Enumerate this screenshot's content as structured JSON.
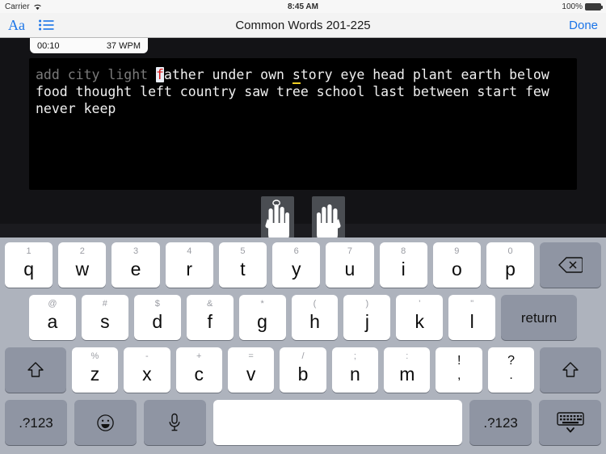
{
  "status_bar": {
    "carrier": "Carrier",
    "wifi_icon": "wifi-icon",
    "time": "8:45 AM",
    "battery_percent": "100%",
    "battery_icon": "battery-icon"
  },
  "nav_bar": {
    "font_button_label": "Aa",
    "font_button_icon": "font-size-icon",
    "list_button_icon": "list-icon",
    "title": "Common Words 201-225",
    "done_label": "Done",
    "accent_color": "#1a74e8"
  },
  "practice": {
    "timer": "00:10",
    "speed": "37 WPM",
    "lines": [
      {
        "segments": [
          {
            "text": "add city light ",
            "state": "done"
          },
          {
            "text": "f",
            "state": "cursor"
          },
          {
            "text": "ather under own ",
            "state": "pending"
          },
          {
            "text": "s",
            "state": "hint"
          },
          {
            "text": "tory eye head plant earth below",
            "state": "pending"
          }
        ]
      },
      {
        "segments": [
          {
            "text": "food thought left country saw tree school last between start few",
            "state": "pending"
          }
        ]
      },
      {
        "segments": [
          {
            "text": "never keep",
            "state": "pending"
          }
        ]
      }
    ],
    "hands": [
      {
        "name": "left-hand-diagram",
        "highlight_finger": "index"
      },
      {
        "name": "right-hand-diagram",
        "highlight_finger": "none"
      }
    ],
    "colors": {
      "background": "#131316",
      "panel": "#000000",
      "typed_text": "#7b7b7b",
      "pending_text": "#f0f0f0",
      "cursor_text": "#d81414",
      "cursor_background": "#e9eef6",
      "hint_underline": "#f2d024"
    }
  },
  "keyboard": {
    "rows": [
      {
        "name": "keyboard-row-1",
        "keys": [
          {
            "main": "q",
            "alt": "1"
          },
          {
            "main": "w",
            "alt": "2"
          },
          {
            "main": "e",
            "alt": "3"
          },
          {
            "main": "r",
            "alt": "4"
          },
          {
            "main": "t",
            "alt": "5"
          },
          {
            "main": "y",
            "alt": "6"
          },
          {
            "main": "u",
            "alt": "7"
          },
          {
            "main": "i",
            "alt": "8"
          },
          {
            "main": "o",
            "alt": "9"
          },
          {
            "main": "p",
            "alt": "0"
          },
          {
            "main": "",
            "alt": "",
            "icon": "backspace-icon",
            "name": "backspace-key"
          }
        ]
      },
      {
        "name": "keyboard-row-2",
        "keys": [
          {
            "main": "a",
            "alt": "@"
          },
          {
            "main": "s",
            "alt": "#"
          },
          {
            "main": "d",
            "alt": "$"
          },
          {
            "main": "f",
            "alt": "&"
          },
          {
            "main": "g",
            "alt": "*"
          },
          {
            "main": "h",
            "alt": "("
          },
          {
            "main": "j",
            "alt": ")"
          },
          {
            "main": "k",
            "alt": "'"
          },
          {
            "main": "l",
            "alt": "\""
          },
          {
            "main": "return",
            "alt": "",
            "name": "return-key"
          }
        ]
      },
      {
        "name": "keyboard-row-3",
        "keys": [
          {
            "main": "",
            "alt": "",
            "icon": "shift-icon",
            "name": "shift-left-key"
          },
          {
            "main": "z",
            "alt": "%"
          },
          {
            "main": "x",
            "alt": "-"
          },
          {
            "main": "c",
            "alt": "+"
          },
          {
            "main": "v",
            "alt": "="
          },
          {
            "main": "b",
            "alt": "/"
          },
          {
            "main": "n",
            "alt": ";"
          },
          {
            "main": "m",
            "alt": ":"
          },
          {
            "main": ",",
            "alt": "!",
            "dual": true
          },
          {
            "main": ".",
            "alt": "?",
            "dual": true
          },
          {
            "main": "",
            "alt": "",
            "icon": "shift-icon",
            "name": "shift-right-key"
          }
        ]
      },
      {
        "name": "keyboard-row-4",
        "keys": [
          {
            "main": ".?123",
            "alt": "",
            "name": "numbers-left-key"
          },
          {
            "main": "",
            "alt": "",
            "icon": "emoji-icon",
            "name": "emoji-key"
          },
          {
            "main": "",
            "alt": "",
            "icon": "microphone-icon",
            "name": "dictation-key"
          },
          {
            "main": "",
            "alt": "",
            "name": "space-key"
          },
          {
            "main": ".?123",
            "alt": "",
            "name": "numbers-right-key"
          },
          {
            "main": "",
            "alt": "",
            "icon": "hide-keyboard-icon",
            "name": "hide-keyboard-key"
          }
        ]
      }
    ],
    "colors": {
      "background": "#aeb3bd",
      "key_light": "#ffffff",
      "key_dark": "#8f95a3"
    }
  }
}
